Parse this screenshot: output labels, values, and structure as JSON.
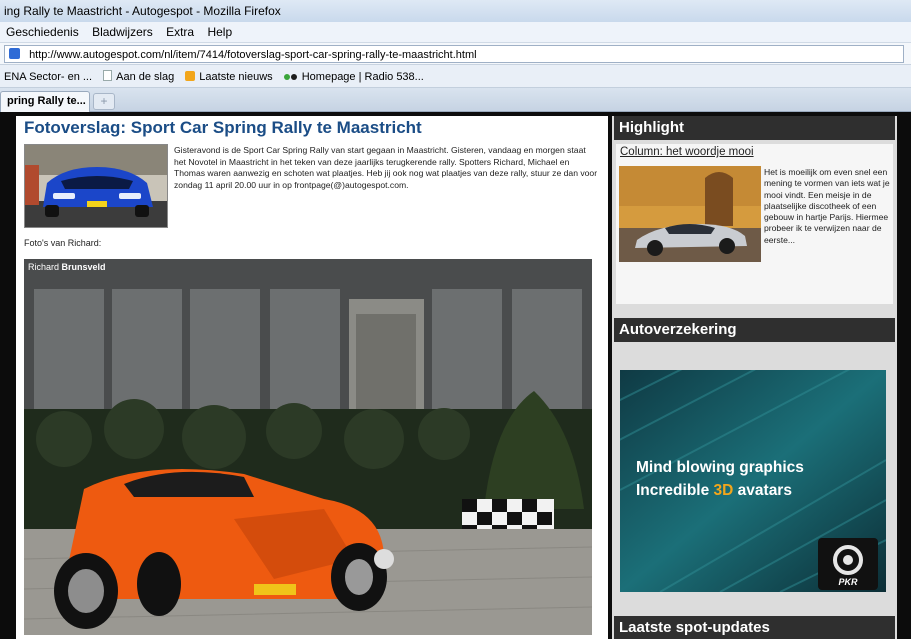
{
  "browser": {
    "title": "ing Rally te Maastricht - Autogespot - Mozilla Firefox",
    "menu": [
      "Geschiedenis",
      "Bladwijzers",
      "Extra",
      "Help"
    ],
    "url": "http://www.autogespot.com/nl/item/7414/fotoverslag-sport-car-spring-rally-te-maastricht.html",
    "bookmarks": [
      "ENA Sector- en ...",
      "Aan de slag",
      "Laatste nieuws",
      "Homepage | Radio 538..."
    ],
    "tab_label": "pring Rally te...",
    "newtab_label": "+"
  },
  "article": {
    "title": "Fotoverslag: Sport Car Spring Rally te Maastricht",
    "intro": "Gisteravond is de Sport Car Spring Rally van start gegaan in Maastricht. Gisteren, vandaag en morgen staat het Novotel in Maastricht in het teken van deze jaarlijks terugkerende rally. Spotters Richard, Michael en Thomas waren aanwezig en schoten wat plaatjes. Heb jij ook nog wat plaatjes van deze rally, stuur ze dan voor zondag 11 april 20.00 uur in op frontpage(@)autogespot.com.",
    "photos_label": "Foto's van Richard:",
    "credit_first": "Richard",
    "credit_last": "Brunsveld"
  },
  "sidebar": {
    "highlight_title": "Highlight",
    "highlight_link": "Column: het woordje mooi",
    "highlight_text": "Het is moeilijk om even snel een mening te vormen van iets wat je mooi vindt. Een meisje in de plaatselijke discotheek of een gebouw in hartje Parijs. Hiermee probeer ik te verwijzen naar de eerste...",
    "insurance_title": "Autoverzekering",
    "ad_line1": "Mind blowing graphics",
    "ad_line2_pre": "Incredible ",
    "ad_line2_3d": "3D",
    "ad_line2_post": " avatars",
    "ad_logo": "PKR",
    "updates_title": "Laatste spot-updates"
  },
  "colors": {
    "title_blue": "#1b4d86",
    "box_header": "#2f2f2f",
    "ad_accent": "#f2a61b",
    "ad_teal": "#1b6f78"
  }
}
